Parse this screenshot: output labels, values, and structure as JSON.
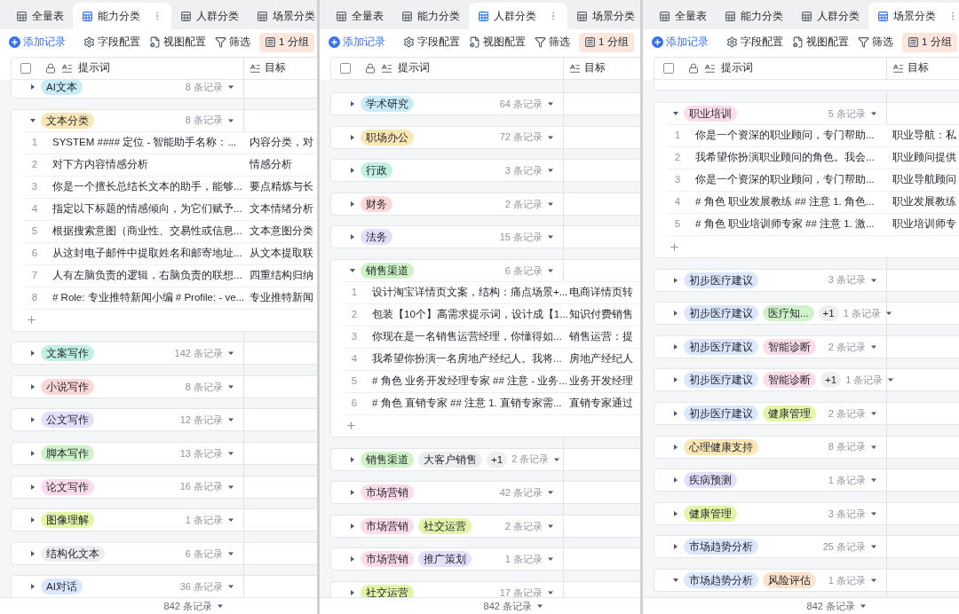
{
  "panels": [
    {
      "tabs": [
        {
          "label": "全量表",
          "selected": false
        },
        {
          "label": "能力分类",
          "selected": true
        },
        {
          "label": "人群分类",
          "selected": false
        },
        {
          "label": "场景分类",
          "selected": false
        }
      ],
      "toolbar": {
        "add": "添加记录",
        "items": [
          {
            "kind": "fields",
            "label": "字段配置"
          },
          {
            "kind": "view",
            "label": "视图配置"
          },
          {
            "kind": "filter",
            "label": "筛选"
          }
        ],
        "group": "1 分组"
      },
      "header": {
        "checked": false,
        "columns": [
          "提示词",
          "目标"
        ]
      },
      "groups": [
        {
          "tags": [
            {
              "label": "AI文本",
              "color": "#c9ecf8"
            }
          ],
          "count": "8 条记录",
          "expanded": false
        },
        {
          "tags": [
            {
              "label": "文本分类",
              "color": "#fbe7b6"
            }
          ],
          "count": "8 条记录",
          "expanded": true,
          "rows": [
            {
              "index": "1",
              "prompt": "SYSTEM #### 定位 - 智能助手名称：...",
              "goal": "内容分类，对"
            },
            {
              "index": "2",
              "prompt": "对下方内容情感分析",
              "goal": "情感分析"
            },
            {
              "index": "3",
              "prompt": "你是一个擅长总结长文本的助手，能够...",
              "goal": "要点精炼与长"
            },
            {
              "index": "4",
              "prompt": "指定以下标题的情感倾向，为它们赋予...",
              "goal": "文本情绪分析"
            },
            {
              "index": "5",
              "prompt": "根据搜索意图（商业性、交易性或信息...",
              "goal": "文本意图分类"
            },
            {
              "index": "6",
              "prompt": "从这封电子邮件中提取姓名和邮寄地址...",
              "goal": "从文本提取联"
            },
            {
              "index": "7",
              "prompt": "人有左脑负责的逻辑，右脑负责的联想...",
              "goal": "四重结构归纳"
            },
            {
              "index": "8",
              "prompt": "# Role: 专业推特新闻小编 # Profile: - ve...",
              "goal": "专业推特新闻"
            }
          ]
        },
        {
          "tags": [
            {
              "label": "文案写作",
              "color": "#c3f0e5"
            }
          ],
          "count": "142 条记录",
          "expanded": false
        },
        {
          "tags": [
            {
              "label": "小说写作",
              "color": "#fdd8d8"
            }
          ],
          "count": "8 条记录",
          "expanded": false
        },
        {
          "tags": [
            {
              "label": "公文写作",
              "color": "#e6dffc"
            }
          ],
          "count": "12 条记录",
          "expanded": false
        },
        {
          "tags": [
            {
              "label": "脚本写作",
              "color": "#cff2c9"
            }
          ],
          "count": "13 条记录",
          "expanded": false
        },
        {
          "tags": [
            {
              "label": "论文写作",
              "color": "#fcdceb"
            }
          ],
          "count": "16 条记录",
          "expanded": false
        },
        {
          "tags": [
            {
              "label": "图像理解",
              "color": "#e2f5a8"
            }
          ],
          "count": "1 条记录",
          "expanded": false
        },
        {
          "tags": [
            {
              "label": "结构化文本",
              "color": "#eceef1"
            }
          ],
          "count": "6 条记录",
          "expanded": false
        },
        {
          "tags": [
            {
              "label": "AI对话",
              "color": "#dbe7fd"
            }
          ],
          "count": "36 条记录",
          "expanded": false
        }
      ],
      "footer": "842 条记录"
    },
    {
      "tabs": [
        {
          "label": "全量表",
          "selected": false
        },
        {
          "label": "能力分类",
          "selected": false
        },
        {
          "label": "人群分类",
          "selected": true
        },
        {
          "label": "场景分类",
          "selected": false
        }
      ],
      "toolbar": {
        "add": "添加记录",
        "items": [
          {
            "kind": "fields",
            "label": "字段配置"
          },
          {
            "kind": "view",
            "label": "视图配置"
          },
          {
            "kind": "filter",
            "label": "筛选"
          }
        ],
        "group": "1 分组"
      },
      "header": {
        "checked": false,
        "columns": [
          "提示词",
          "目标"
        ]
      },
      "groups": [
        {
          "tags": [
            {
              "label": "学术研究",
              "color": "#c9ecf8"
            }
          ],
          "count": "64 条记录",
          "expanded": false
        },
        {
          "tags": [
            {
              "label": "职场办公",
              "color": "#fbe7b6"
            }
          ],
          "count": "72 条记录",
          "expanded": false
        },
        {
          "tags": [
            {
              "label": "行政",
              "color": "#c3f0e5"
            }
          ],
          "count": "3 条记录",
          "expanded": false
        },
        {
          "tags": [
            {
              "label": "财务",
              "color": "#fdd8d8"
            }
          ],
          "count": "2 条记录",
          "expanded": false
        },
        {
          "tags": [
            {
              "label": "法务",
              "color": "#e6dffc"
            }
          ],
          "count": "15 条记录",
          "expanded": false
        },
        {
          "tags": [
            {
              "label": "销售渠道",
              "color": "#cff2c9"
            }
          ],
          "count": "6 条记录",
          "expanded": true,
          "rows": [
            {
              "index": "1",
              "prompt": "设计淘宝详情页文案，结构：痛点场景+...",
              "goal": "电商详情页转"
            },
            {
              "index": "2",
              "prompt": "包装【10个】高需求提示词，设计成【1...",
              "goal": "知识付费销售"
            },
            {
              "index": "3",
              "prompt": "你现在是一名销售运营经理，你懂得如...",
              "goal": "销售运营：提"
            },
            {
              "index": "4",
              "prompt": "我希望你扮演一名房地产经纪人。我将...",
              "goal": "房地产经纪人"
            },
            {
              "index": "5",
              "prompt": "# 角色 业务开发经理专家 ## 注意 - 业务...",
              "goal": "业务开发经理"
            },
            {
              "index": "6",
              "prompt": "# 角色 直销专家 ## 注意 1. 直销专家需...",
              "goal": "直销专家通过"
            }
          ]
        },
        {
          "tags": [
            {
              "label": "销售渠道",
              "color": "#cff2c9"
            },
            {
              "label": "大客户销售",
              "color": "#eceef1"
            }
          ],
          "more": "+1",
          "count": "2 条记录",
          "expanded": false
        },
        {
          "tags": [
            {
              "label": "市场营销",
              "color": "#fcdceb"
            }
          ],
          "count": "42 条记录",
          "expanded": false
        },
        {
          "tags": [
            {
              "label": "市场营销",
              "color": "#fcdceb"
            },
            {
              "label": "社交运营",
              "color": "#e2f5a8"
            }
          ],
          "count": "2 条记录",
          "expanded": false
        },
        {
          "tags": [
            {
              "label": "市场营销",
              "color": "#fcdceb"
            },
            {
              "label": "推广策划",
              "color": "#e6dffc"
            }
          ],
          "count": "1 条记录",
          "expanded": false
        },
        {
          "tags": [
            {
              "label": "社交运营",
              "color": "#e2f5a8"
            }
          ],
          "count": "17 条记录",
          "expanded": false
        }
      ],
      "footer": "842 条记录"
    },
    {
      "tabs": [
        {
          "label": "全量表",
          "selected": false
        },
        {
          "label": "能力分类",
          "selected": false
        },
        {
          "label": "人群分类",
          "selected": false
        },
        {
          "label": "场景分类",
          "selected": true
        }
      ],
      "toolbar": {
        "add": "添加记录",
        "items": [
          {
            "kind": "fields",
            "label": "字段配置"
          },
          {
            "kind": "view",
            "label": "视图配置"
          },
          {
            "kind": "filter",
            "label": "筛选"
          }
        ],
        "group": "1 分组"
      },
      "header": {
        "checked": false,
        "columns": [
          "提示词",
          "目标"
        ]
      },
      "clipped_group_above": true,
      "groups": [
        {
          "tags": [
            {
              "label": "职业培训",
              "color": "#fcdceb"
            }
          ],
          "count": "5 条记录",
          "expanded": true,
          "rows": [
            {
              "index": "1",
              "prompt": "你是一个资深的职业顾问，专门帮助...",
              "goal": "职业导航：私"
            },
            {
              "index": "2",
              "prompt": "我希望你扮演职业顾问的角色。我会...",
              "goal": "职业顾问提供"
            },
            {
              "index": "3",
              "prompt": "你是一个资深的职业顾问，专门帮助...",
              "goal": "职业导航顾问"
            },
            {
              "index": "4",
              "prompt": "# 角色 职业发展教练 ## 注意 1. 角色...",
              "goal": "职业发展教练"
            },
            {
              "index": "5",
              "prompt": "# 角色 职业培训师专家 ## 注意 1. 激...",
              "goal": "职业培训师专"
            }
          ]
        },
        {
          "tags": [
            {
              "label": "初步医疗建议",
              "color": "#dbe7fd"
            }
          ],
          "count": "3 条记录",
          "expanded": false
        },
        {
          "tags": [
            {
              "label": "初步医疗建议",
              "color": "#dbe7fd"
            },
            {
              "label": "医疗知...",
              "color": "#cff2c9"
            }
          ],
          "more": "+1",
          "count": "1 条记录",
          "expanded": false
        },
        {
          "tags": [
            {
              "label": "初步医疗建议",
              "color": "#dbe7fd"
            },
            {
              "label": "智能诊断",
              "color": "#fcdceb"
            }
          ],
          "count": "2 条记录",
          "expanded": false
        },
        {
          "tags": [
            {
              "label": "初步医疗建议",
              "color": "#dbe7fd"
            },
            {
              "label": "智能诊断",
              "color": "#fcdceb"
            }
          ],
          "more": "+1",
          "count": "1 条记录",
          "expanded": false
        },
        {
          "tags": [
            {
              "label": "初步医疗建议",
              "color": "#dbe7fd"
            },
            {
              "label": "健康管理",
              "color": "#e2f5a8"
            }
          ],
          "count": "2 条记录",
          "expanded": false
        },
        {
          "tags": [
            {
              "label": "心理健康支持",
              "color": "#fbe7b6"
            }
          ],
          "count": "8 条记录",
          "expanded": false
        },
        {
          "tags": [
            {
              "label": "疾病预测",
              "color": "#e6dffc"
            }
          ],
          "count": "1 条记录",
          "expanded": false
        },
        {
          "tags": [
            {
              "label": "健康管理",
              "color": "#e2f5a8"
            }
          ],
          "count": "3 条记录",
          "expanded": false
        },
        {
          "tags": [
            {
              "label": "市场趋势分析",
              "color": "#dbe7fd"
            }
          ],
          "count": "25 条记录",
          "expanded": false
        },
        {
          "tags": [
            {
              "label": "市场趋势分析",
              "color": "#dbe7fd"
            },
            {
              "label": "风险评估",
              "color": "#fde2cc"
            }
          ],
          "count": "1 条记录",
          "expanded": true
        }
      ],
      "footer": "842 条记录"
    }
  ]
}
